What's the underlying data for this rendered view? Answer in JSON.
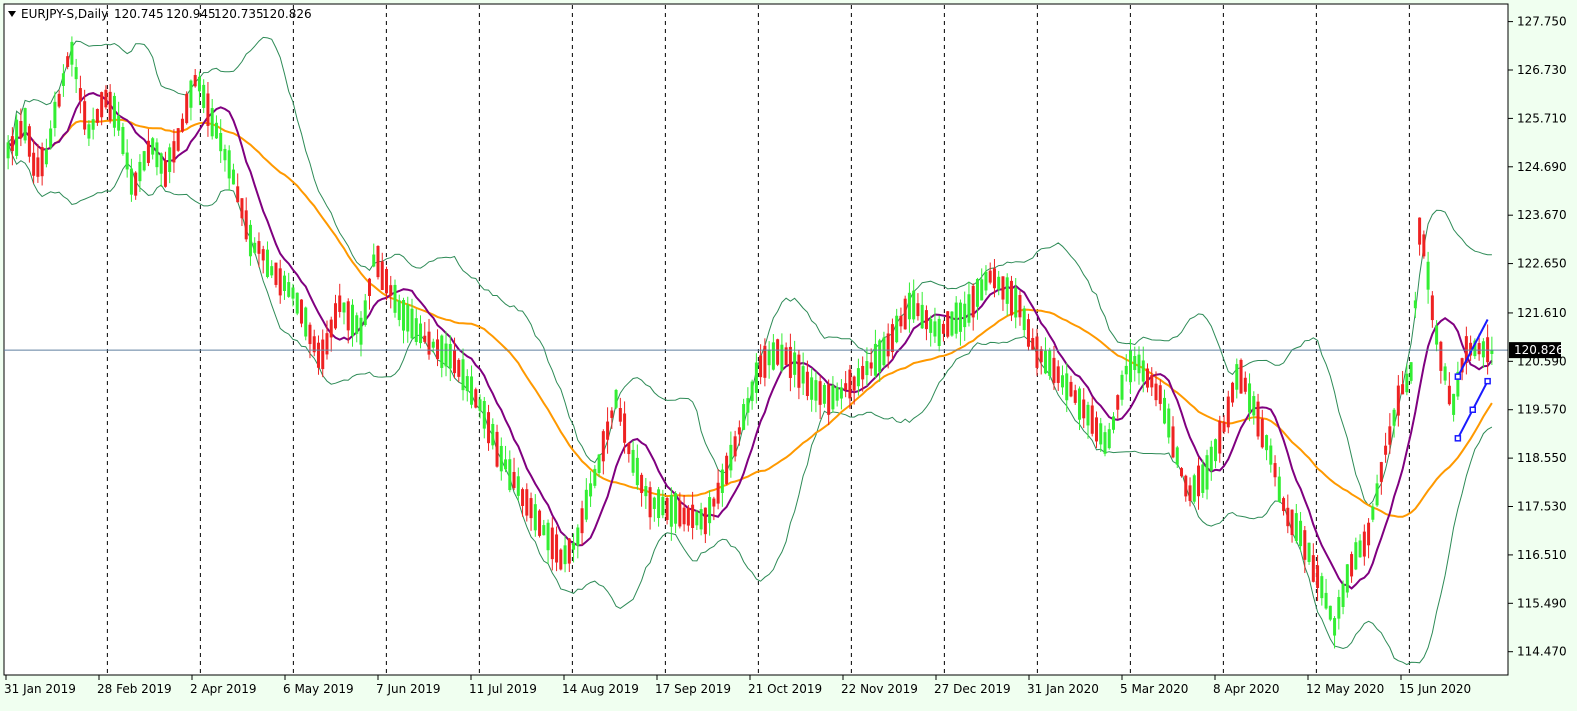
{
  "chart_data": {
    "type": "candlestick",
    "header": {
      "symbol_period": "EURJPY-S,Daily",
      "open": "120.745",
      "high": "120.945",
      "low": "120.735",
      "close": "120.826"
    },
    "current_price": 120.826,
    "current_price_label": "120.826",
    "ylim": [
      114.0,
      128.1
    ],
    "y_ticks": [
      "127.750",
      "126.730",
      "125.710",
      "124.690",
      "123.670",
      "122.650",
      "121.610",
      "120.590",
      "119.570",
      "118.550",
      "117.530",
      "116.510",
      "115.490",
      "114.470"
    ],
    "x_labels": [
      "31 Jan 2019",
      "28 Feb 2019",
      "2 Apr 2019",
      "6 May 2019",
      "7 Jun 2019",
      "11 Jul 2019",
      "14 Aug 2019",
      "17 Sep 2019",
      "21 Oct 2019",
      "22 Nov 2019",
      "27 Dec 2019",
      "31 Jan 2020",
      "5 Mar 2020",
      "8 Apr 2020",
      "12 May 2020",
      "15 Jun 2020"
    ],
    "x_range_bars": 350,
    "price_path": [
      [
        0,
        125.0
      ],
      [
        10,
        125.6
      ],
      [
        15,
        124.6
      ],
      [
        22,
        125.0
      ],
      [
        30,
        126.4
      ],
      [
        35,
        127.2
      ],
      [
        45,
        125.4
      ],
      [
        55,
        126.2
      ],
      [
        62,
        125.6
      ],
      [
        70,
        124.2
      ],
      [
        80,
        125.2
      ],
      [
        88,
        124.6
      ],
      [
        95,
        125.2
      ],
      [
        105,
        126.6
      ],
      [
        115,
        125.6
      ],
      [
        125,
        124.6
      ],
      [
        135,
        123.2
      ],
      [
        150,
        122.4
      ],
      [
        160,
        122.0
      ],
      [
        175,
        120.6
      ],
      [
        185,
        121.8
      ],
      [
        198,
        121.2
      ],
      [
        205,
        122.8
      ],
      [
        220,
        121.6
      ],
      [
        235,
        121.0
      ],
      [
        250,
        120.6
      ],
      [
        265,
        119.6
      ],
      [
        275,
        118.6
      ],
      [
        290,
        117.6
      ],
      [
        300,
        117.0
      ],
      [
        310,
        116.4
      ],
      [
        318,
        116.8
      ],
      [
        330,
        118.4
      ],
      [
        340,
        119.8
      ],
      [
        350,
        118.4
      ],
      [
        360,
        117.6
      ],
      [
        375,
        117.4
      ],
      [
        390,
        117.2
      ],
      [
        405,
        118.6
      ],
      [
        420,
        120.4
      ],
      [
        430,
        120.8
      ],
      [
        440,
        120.5
      ],
      [
        450,
        120.0
      ],
      [
        460,
        119.8
      ],
      [
        475,
        120.2
      ],
      [
        490,
        120.8
      ],
      [
        505,
        121.8
      ],
      [
        520,
        121.2
      ],
      [
        535,
        121.6
      ],
      [
        550,
        122.4
      ],
      [
        565,
        121.8
      ],
      [
        575,
        120.8
      ],
      [
        590,
        120.2
      ],
      [
        605,
        119.4
      ],
      [
        615,
        118.8
      ],
      [
        625,
        120.4
      ],
      [
        632,
        120.6
      ],
      [
        645,
        119.8
      ],
      [
        660,
        117.8
      ],
      [
        670,
        118.2
      ],
      [
        680,
        119.2
      ],
      [
        688,
        120.4
      ],
      [
        695,
        119.8
      ],
      [
        705,
        118.8
      ],
      [
        715,
        117.4
      ],
      [
        725,
        116.8
      ],
      [
        735,
        115.8
      ],
      [
        742,
        115.0
      ],
      [
        752,
        116.4
      ],
      [
        760,
        116.8
      ],
      [
        770,
        118.6
      ],
      [
        778,
        119.8
      ],
      [
        785,
        120.4
      ],
      [
        790,
        123.6
      ],
      [
        795,
        122.2
      ],
      [
        800,
        120.9
      ],
      [
        808,
        119.6
      ],
      [
        815,
        120.8
      ],
      [
        822,
        120.9
      ],
      [
        830,
        120.8
      ]
    ]
  }
}
